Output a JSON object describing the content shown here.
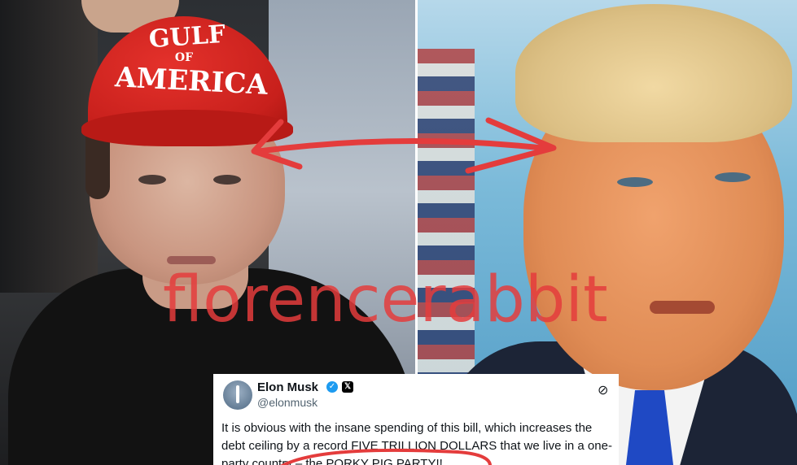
{
  "image": {
    "left_subject": {
      "cap_text": [
        "GULF",
        "OF",
        "AMERICA"
      ]
    },
    "watermark": "florencerabbit",
    "colors": {
      "cap_red": "#d42420",
      "annotation_red": "#e43c3c",
      "tie_blue": "#1f49c4"
    }
  },
  "tweet": {
    "name": "Elon Musk",
    "handle": "@elonmusk",
    "verified_icon": "✓",
    "x_badge_icon": "𝕏",
    "grok_icon": "⊘",
    "text": "It is obvious with the insane spending of this bill, which increases the debt ceiling by a record FIVE TRILLION DOLLARS that we live in a one-party country – the PORKY PIG PARTY!!"
  }
}
